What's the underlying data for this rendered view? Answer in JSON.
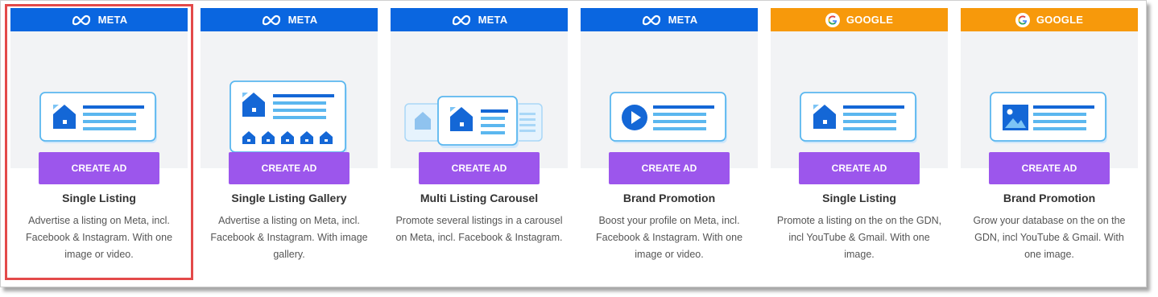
{
  "colors": {
    "meta": "#0a66e0",
    "google": "#f7990b",
    "button": "#9c56ec",
    "highlight": "#e34a4a"
  },
  "cards": [
    {
      "brand": "META",
      "brand_icon": "meta-icon",
      "button": "CREATE AD",
      "title": "Single Listing",
      "description": "Advertise a listing on Meta, incl. Facebook & Instagram. With one image or video."
    },
    {
      "brand": "META",
      "brand_icon": "meta-icon",
      "button": "CREATE AD",
      "title": "Single Listing Gallery",
      "description": "Advertise a listing on Meta, incl. Facebook & Instagram. With image gallery."
    },
    {
      "brand": "META",
      "brand_icon": "meta-icon",
      "button": "CREATE AD",
      "title": "Multi Listing Carousel",
      "description": "Promote several listings in a carousel on Meta, incl. Facebook & Instagram."
    },
    {
      "brand": "META",
      "brand_icon": "meta-icon",
      "button": "CREATE AD",
      "title": "Brand Promotion",
      "description": "Boost your profile on Meta, incl. Facebook & Instagram. With one image or video."
    },
    {
      "brand": "GOOGLE",
      "brand_icon": "google-icon",
      "button": "CREATE AD",
      "title": "Single Listing",
      "description": "Promote a listing on the on the GDN, incl YouTube & Gmail. With one image."
    },
    {
      "brand": "GOOGLE",
      "brand_icon": "google-icon",
      "button": "CREATE AD",
      "title": "Brand Promotion",
      "description": "Grow your database on the on the GDN, incl YouTube & Gmail. With one image."
    }
  ]
}
